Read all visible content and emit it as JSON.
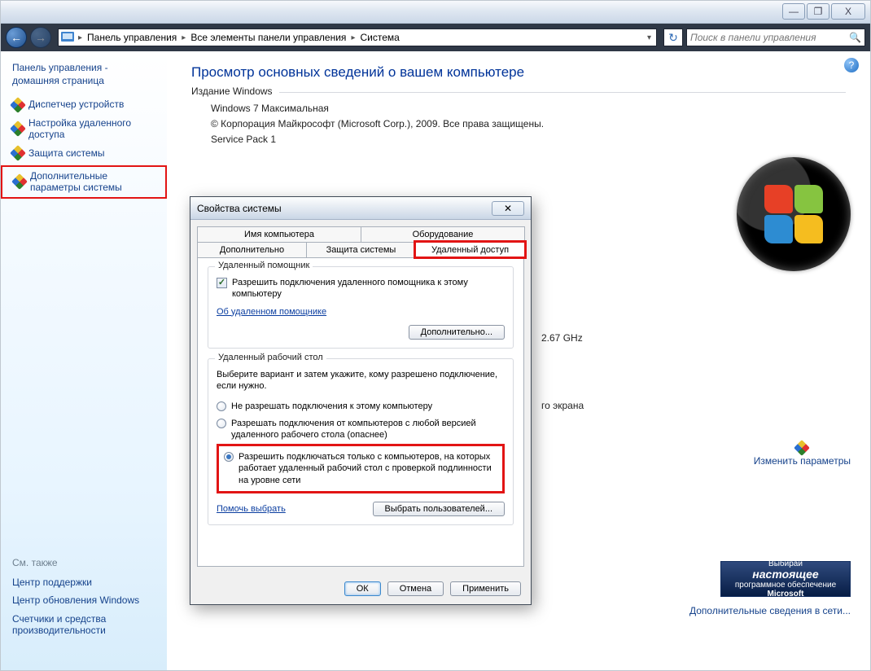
{
  "titlebar": {
    "minimize": "—",
    "maximize": "❐",
    "close": "X"
  },
  "nav": {
    "back": "←",
    "forward": "→"
  },
  "breadcrumb": {
    "item1": "Панель управления",
    "item2": "Все элементы панели управления",
    "item3": "Система"
  },
  "search": {
    "placeholder": "Поиск в панели управления"
  },
  "sidebar": {
    "home": "Панель управления - домашняя страница",
    "device_manager": "Диспетчер устройств",
    "remote_settings": "Настройка удаленного доступа",
    "system_protection": "Защита системы",
    "advanced": "Дополнительные параметры системы",
    "see_also": "См. также",
    "action_center": "Центр поддержки",
    "windows_update": "Центр обновления Windows",
    "perf_tools": "Счетчики и средства производительности"
  },
  "main": {
    "title": "Просмотр основных сведений о вашем компьютере",
    "edition_legend": "Издание Windows",
    "edition_name": "Windows 7 Максимальная",
    "copyright": "© Корпорация Майкрософт (Microsoft Corp.), 2009. Все права защищены.",
    "sp": "Service Pack 1",
    "proc_suffix": "2.67 GHz",
    "screen_suffix": "го экрана",
    "change": "Изменить параметры",
    "genuine1": "Выбирай",
    "genuine2": "настоящее",
    "genuine3": "программное обеспечение",
    "genuine4": "Microsoft",
    "more_online": "Дополнительные сведения в сети..."
  },
  "dialog": {
    "title": "Свойства системы",
    "tabs": {
      "computer_name": "Имя компьютера",
      "hardware": "Оборудование",
      "advanced": "Дополнительно",
      "protection": "Защита системы",
      "remote": "Удаленный доступ"
    },
    "remote_assist": {
      "legend": "Удаленный помощник",
      "allow": "Разрешить подключения удаленного помощника к этому компьютеру",
      "about": "Об удаленном помощнике",
      "advanced_btn": "Дополнительно..."
    },
    "rdp": {
      "legend": "Удаленный рабочий стол",
      "desc": "Выберите вариант и затем укажите, кому разрешено подключение, если нужно.",
      "opt1": "Не разрешать подключения к этому компьютеру",
      "opt2": "Разрешать подключения от компьютеров с любой версией удаленного рабочего стола (опаснее)",
      "opt3": "Разрешить подключаться только с компьютеров, на которых работает удаленный рабочий стол с проверкой подлинности на уровне сети",
      "help_choose": "Помочь выбрать",
      "select_users": "Выбрать пользователей..."
    },
    "buttons": {
      "ok": "ОК",
      "cancel": "Отмена",
      "apply": "Применить"
    }
  }
}
